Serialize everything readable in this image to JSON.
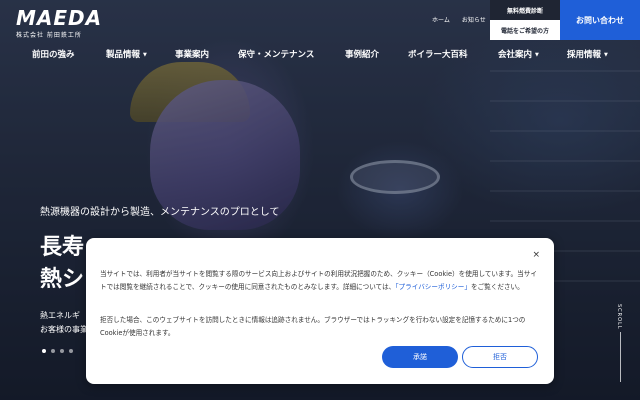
{
  "brand": {
    "wordmark": "MAEDA",
    "company": "株式会社 前田鉄工所"
  },
  "header": {
    "util_links": [
      "ホーム",
      "お知らせ"
    ],
    "cta_diagnosis": "無料燃費診断",
    "cta_consult": "電話をご希望の方",
    "cta_contact": "お問い合わせ"
  },
  "nav": [
    {
      "label": "前田の強み",
      "has_dropdown": false
    },
    {
      "label": "製品情報",
      "has_dropdown": true
    },
    {
      "label": "事業案内",
      "has_dropdown": false
    },
    {
      "label": "保守・メンテナンス",
      "has_dropdown": false
    },
    {
      "label": "事例紹介",
      "has_dropdown": false
    },
    {
      "label": "ボイラー大百科",
      "has_dropdown": false
    },
    {
      "label": "会社案内",
      "has_dropdown": true
    },
    {
      "label": "採用情報",
      "has_dropdown": true
    }
  ],
  "hero": {
    "tagline": "熱源機器の設計から製造、メンテナンスのプロとして",
    "headline_line1": "長寿",
    "headline_line2": "熱シ",
    "subcopy_line1": "熱エネルギ",
    "subcopy_line2": "お客様の事業",
    "slides": 4,
    "active_slide": 0,
    "scroll_label": "SCROLL"
  },
  "cookie_banner": {
    "close_label": "×",
    "para1_a": "当サイトでは、利用者が当サイトを閲覧する際のサービス向上およびサイトの利用状況把握のため、クッキー（Cookie）を使用しています。当サイトでは閲覧を継続されることで、クッキーの使用に同意されたものとみなします。詳細については、",
    "para1_link": "「プライバシーポリシー」",
    "para1_b": "をご覧ください。",
    "para2": "拒否した場合、このウェブサイトを訪問したときに情報は追跡されません。ブラウザーではトラッキングを行わない設定を記憶するために1つのCookieが使用されます。",
    "accept_label": "承諾",
    "decline_label": "拒否"
  },
  "colors": {
    "accent": "#1f5fd8",
    "dark": "#1f2533"
  }
}
